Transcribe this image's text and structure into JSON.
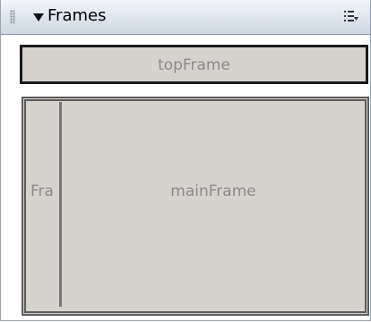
{
  "panel": {
    "title": "Frames"
  },
  "frames": {
    "top": "topFrame",
    "left": "Fra",
    "main": "mainFrame"
  },
  "icons": {
    "grip": "grip-icon",
    "collapse": "collapse-triangle-icon",
    "options": "options-menu-icon"
  }
}
